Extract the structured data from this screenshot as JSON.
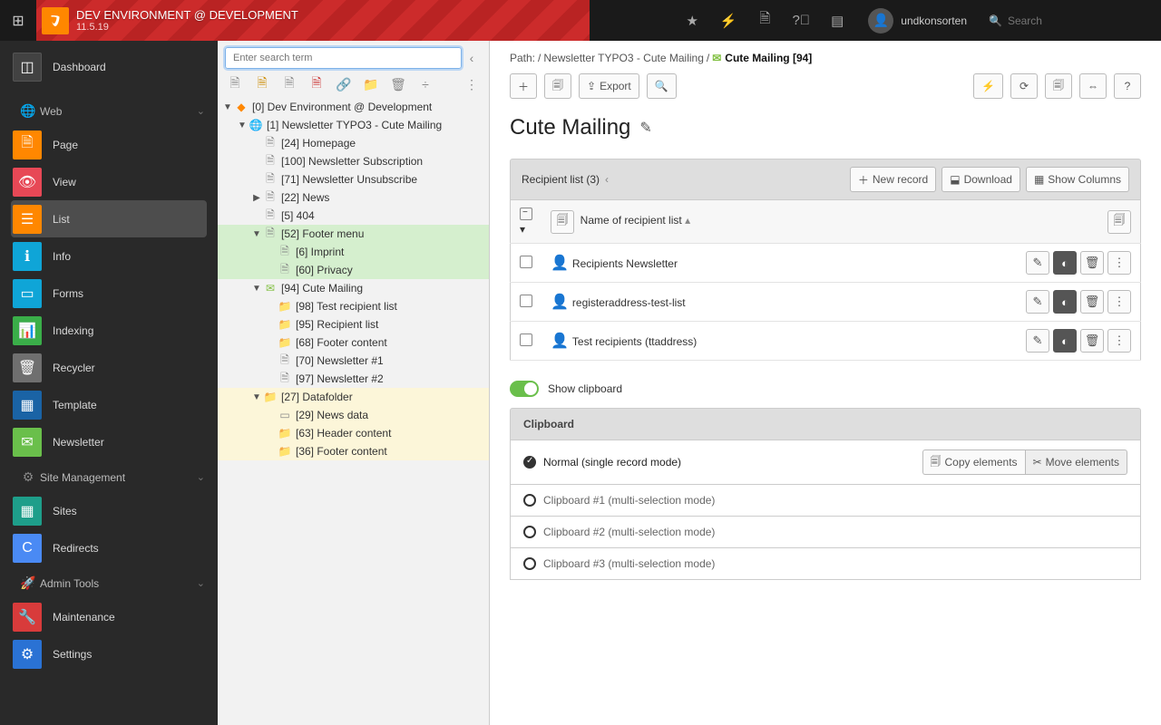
{
  "topbar": {
    "site_name": "DEV ENVIRONMENT @ DEVELOPMENT",
    "version": "11.5.19",
    "user": "undkonsorten",
    "search_placeholder": "Search"
  },
  "modmenu": {
    "dashboard": "Dashboard",
    "groups": {
      "web": "Web",
      "site": "Site Management",
      "admin": "Admin Tools"
    },
    "web_items": [
      "Page",
      "View",
      "List",
      "Info",
      "Forms",
      "Indexing",
      "Recycler",
      "Template",
      "Newsletter"
    ],
    "site_items": [
      "Sites",
      "Redirects"
    ],
    "admin_items": [
      "Maintenance",
      "Settings"
    ]
  },
  "pagetree": {
    "search_placeholder": "Enter search term",
    "nodes": [
      {
        "id": 0,
        "l": 0,
        "tw": "▼",
        "icon": "typo3",
        "label": "[0] Dev Environment @ Development"
      },
      {
        "id": 1,
        "l": 1,
        "tw": "▼",
        "icon": "globe",
        "label": "[1] Newsletter TYPO3 - Cute Mailing"
      },
      {
        "id": 24,
        "l": 2,
        "tw": "",
        "icon": "pageup",
        "label": "[24] Homepage"
      },
      {
        "id": 100,
        "l": 2,
        "tw": "",
        "icon": "page",
        "label": "[100] Newsletter Subscription"
      },
      {
        "id": 71,
        "l": 2,
        "tw": "",
        "icon": "page",
        "label": "[71] Newsletter Unsubscribe"
      },
      {
        "id": 22,
        "l": 2,
        "tw": "▶",
        "icon": "page",
        "label": "[22] News"
      },
      {
        "id": 5,
        "l": 2,
        "tw": "",
        "icon": "page",
        "label": "[5] 404"
      },
      {
        "id": 52,
        "l": 2,
        "tw": "▼",
        "icon": "pageup",
        "label": "[52] Footer menu",
        "hl": "green"
      },
      {
        "id": 6,
        "l": 3,
        "tw": "",
        "icon": "page",
        "label": "[6] Imprint",
        "hl": "green"
      },
      {
        "id": 60,
        "l": 3,
        "tw": "",
        "icon": "page",
        "label": "[60] Privacy",
        "hl": "green"
      },
      {
        "id": 94,
        "l": 2,
        "tw": "▼",
        "icon": "env",
        "label": "[94] Cute Mailing"
      },
      {
        "id": 98,
        "l": 3,
        "tw": "",
        "icon": "folder",
        "label": "[98] Test recipient list"
      },
      {
        "id": 95,
        "l": 3,
        "tw": "",
        "icon": "folder",
        "label": "[95] Recipient list"
      },
      {
        "id": 68,
        "l": 3,
        "tw": "",
        "icon": "folder",
        "label": "[68] Footer content"
      },
      {
        "id": 70,
        "l": 3,
        "tw": "",
        "icon": "page",
        "label": "[70] Newsletter #1"
      },
      {
        "id": 97,
        "l": 3,
        "tw": "",
        "icon": "page",
        "label": "[97] Newsletter #2"
      },
      {
        "id": 27,
        "l": 2,
        "tw": "▼",
        "icon": "folder",
        "label": "[27] Datafolder",
        "hl": "yellow"
      },
      {
        "id": 29,
        "l": 3,
        "tw": "",
        "icon": "plugin",
        "label": "[29] News data",
        "hl": "yellow"
      },
      {
        "id": 63,
        "l": 3,
        "tw": "",
        "icon": "folder",
        "label": "[63] Header content",
        "hl": "yellow"
      },
      {
        "id": 36,
        "l": 3,
        "tw": "",
        "icon": "folder",
        "label": "[36] Footer content",
        "hl": "yellow"
      }
    ]
  },
  "content": {
    "path_prefix": "Path: ",
    "path_root": "/",
    "path_seg1": "Newsletter TYPO3 - Cute Mailing",
    "path_sep": "/",
    "path_current": "Cute Mailing [94]",
    "export_label": "Export",
    "page_title": "Cute Mailing",
    "panel_title": "Recipient list (3)",
    "new_record": "New record",
    "download": "Download",
    "show_columns": "Show Columns",
    "col_name": "Name of recipient list",
    "rows": [
      {
        "name": "Recipients Newsletter"
      },
      {
        "name": "registeraddress-test-list"
      },
      {
        "name": "Test recipients (ttaddress)"
      }
    ],
    "show_clipboard": "Show clipboard",
    "clipboard_title": "Clipboard",
    "copy_elements": "Copy elements",
    "move_elements": "Move elements",
    "clip_rows": [
      "Normal (single record mode)",
      "Clipboard #1 (multi-selection mode)",
      "Clipboard #2 (multi-selection mode)",
      "Clipboard #3 (multi-selection mode)"
    ]
  }
}
